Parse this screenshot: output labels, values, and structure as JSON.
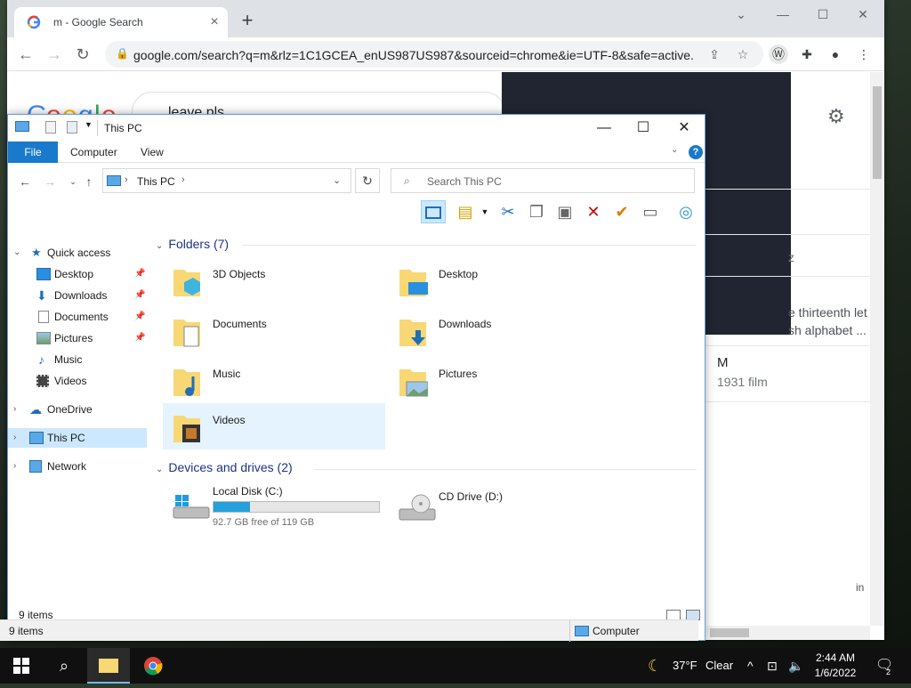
{
  "chrome": {
    "tab_title": "m - Google Search",
    "new_tab": "+",
    "url": "google.com/search?q=m&rlz=1C1GCEA_enUS987US987&sourceid=chrome&ie=UTF-8&safe=active...",
    "search_query": "leave pls",
    "kp_snippet_1": "e thirteenth let",
    "kp_snippet_2": "sh alphabet ...",
    "kp_letter": "z",
    "kp_result_title": "M",
    "kp_result_sub": "1931 film",
    "side_fragment": "in"
  },
  "explorer": {
    "title": "This PC",
    "tabs": {
      "file": "File",
      "computer": "Computer",
      "view": "View"
    },
    "address": "This PC",
    "search_placeholder": "Search This PC",
    "nav": {
      "quick_access": "Quick access",
      "desktop": "Desktop",
      "downloads": "Downloads",
      "documents": "Documents",
      "pictures": "Pictures",
      "music": "Music",
      "videos": "Videos",
      "onedrive": "OneDrive",
      "this_pc": "This PC",
      "network": "Network"
    },
    "folders_header": "Folders (7)",
    "folders": {
      "objects3d": "3D Objects",
      "desktop": "Desktop",
      "documents": "Documents",
      "downloads": "Downloads",
      "music": "Music",
      "pictures": "Pictures",
      "videos": "Videos"
    },
    "drives_header": "Devices and drives (2)",
    "drives": {
      "c_name": "Local Disk (C:)",
      "c_free": "92.7 GB free of 119 GB",
      "c_used_fraction": 0.22,
      "d_name": "CD Drive (D:)"
    },
    "status_items": "9 items"
  },
  "host_status": {
    "items": "9 items",
    "location": "Computer"
  },
  "taskbar": {
    "weather_temp": "37°F",
    "weather_desc": "Clear",
    "time": "2:44 AM",
    "date": "1/6/2022",
    "notif_count": "2"
  },
  "colors": {
    "accent": "#1979ca",
    "selection": "#cce8ff",
    "drive_fill": "#26a0da",
    "folder": "#f8d775"
  }
}
